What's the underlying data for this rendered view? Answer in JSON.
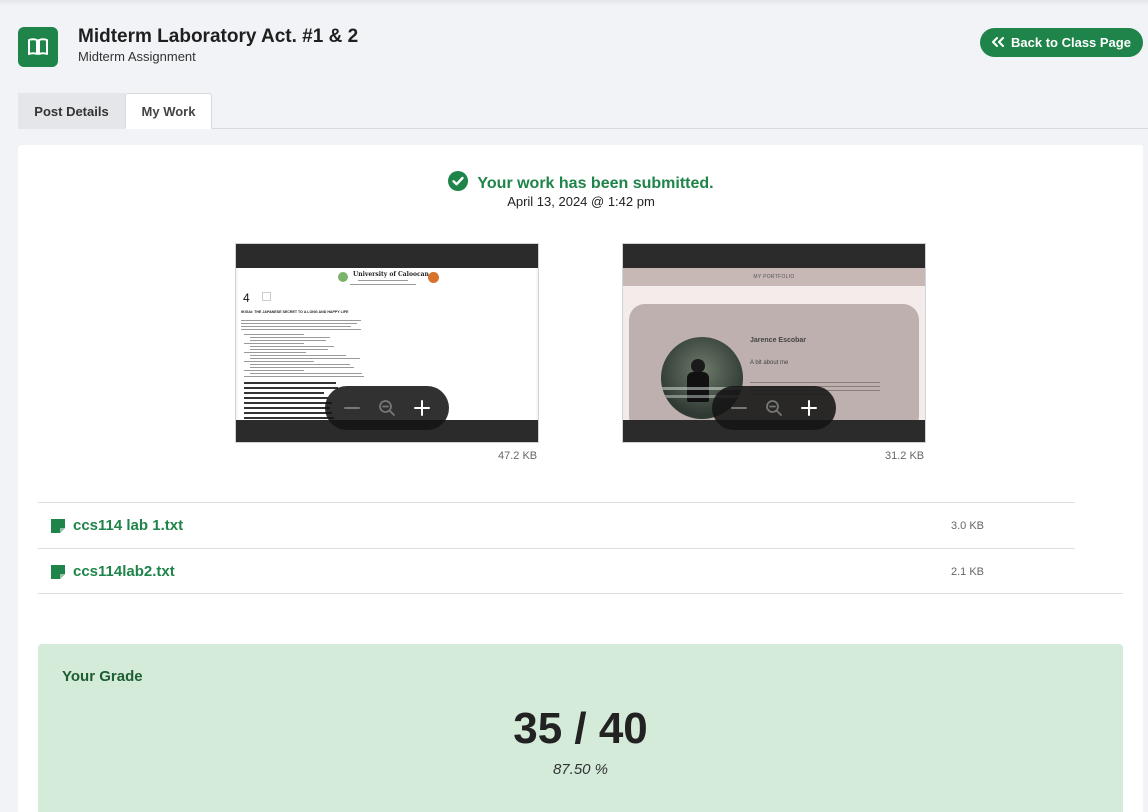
{
  "header": {
    "title": "Midterm Laboratory Act. #1 & 2",
    "subtitle": "Midterm Assignment",
    "back_button": "Back to Class Page",
    "icon": "book-icon"
  },
  "tabs": [
    {
      "label": "Post Details",
      "active": false
    },
    {
      "label": "My Work",
      "active": true
    }
  ],
  "submission": {
    "status": "Your work has been submitted.",
    "date": "April 13, 2024 @ 1:42 pm"
  },
  "attachments": [
    {
      "size": "47.2 KB",
      "preview": {
        "page_number": "4",
        "university": "University of Caloocan",
        "heading": "IKIGAI: THE JAPANESE SECRET TO A LONG AND HAPPY LIFE"
      }
    },
    {
      "size": "31.2 KB",
      "preview": {
        "header": "MY PORTFOLIO",
        "name": "Jarence Escobar",
        "about": "A bit about me"
      }
    }
  ],
  "files": [
    {
      "name": "ccs114 lab 1.txt",
      "size": "3.0 KB"
    },
    {
      "name": "ccs114lab2.txt",
      "size": "2.1 KB"
    }
  ],
  "grade": {
    "label": "Your Grade",
    "score": "35 / 40",
    "percent": "87.50 %"
  },
  "colors": {
    "accent": "#1e8449",
    "grade_bg": "#d4ebd9",
    "page_bg": "#f1f3f6"
  }
}
